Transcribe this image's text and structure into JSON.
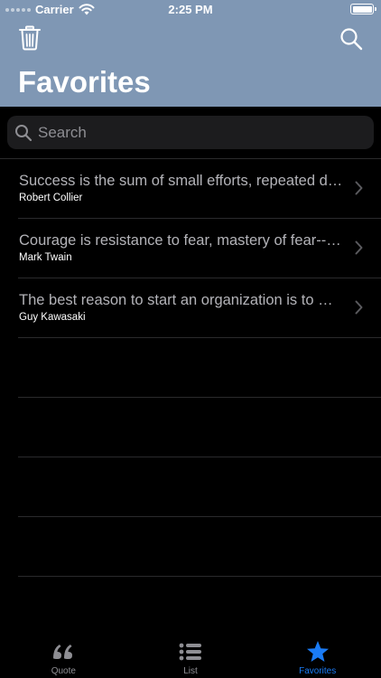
{
  "status_bar": {
    "carrier": "Carrier",
    "time": "2:25 PM"
  },
  "header": {
    "title": "Favorites"
  },
  "search": {
    "placeholder": "Search",
    "value": ""
  },
  "favorites": [
    {
      "quote": "Success is the sum of small efforts, repeated day in and day out.",
      "author": "Robert Collier"
    },
    {
      "quote": "Courage is resistance to fear, mastery of fear--not absence of fear.",
      "author": "Mark Twain"
    },
    {
      "quote": "The best reason to start an organization is to make meaning.",
      "author": "Guy Kawasaki"
    }
  ],
  "tabs": [
    {
      "label": "Quote",
      "icon": "quote-icon",
      "active": false
    },
    {
      "label": "List",
      "icon": "list-icon",
      "active": false
    },
    {
      "label": "Favorites",
      "icon": "star-icon",
      "active": true
    }
  ],
  "colors": {
    "header": "#7f97b4",
    "accent": "#1a7bf5",
    "background": "#000000"
  }
}
